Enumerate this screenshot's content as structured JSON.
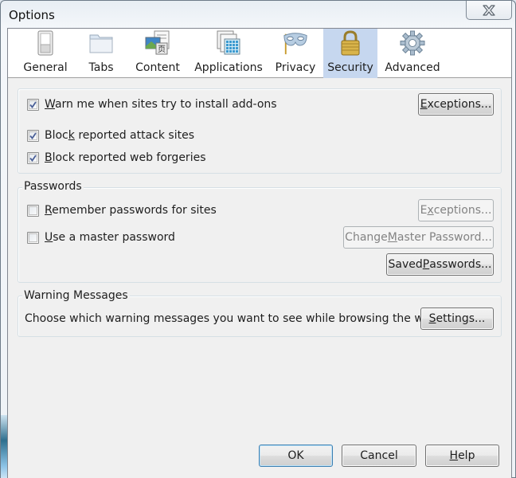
{
  "window": {
    "title": "Options",
    "close_label": "Close"
  },
  "panes": [
    {
      "id": "general",
      "label": "General",
      "icon": "switch-icon",
      "selected": false
    },
    {
      "id": "tabs",
      "label": "Tabs",
      "icon": "folder-tabs-icon",
      "selected": false
    },
    {
      "id": "content",
      "label": "Content",
      "icon": "content-page-icon",
      "selected": false
    },
    {
      "id": "applications",
      "label": "Applications",
      "icon": "applications-grid-icon",
      "selected": false
    },
    {
      "id": "privacy",
      "label": "Privacy",
      "icon": "mask-icon",
      "selected": false
    },
    {
      "id": "security",
      "label": "Security",
      "icon": "padlock-icon",
      "selected": true
    },
    {
      "id": "advanced",
      "label": "Advanced",
      "icon": "gear-icon",
      "selected": false
    }
  ],
  "security": {
    "addons": {
      "checked": true,
      "label_pre": "",
      "label_access": "W",
      "label_post": "arn me when sites try to install add-ons",
      "exceptions_button": {
        "pre": "",
        "access": "E",
        "post": "xceptions...",
        "enabled": true
      }
    },
    "attack_sites": {
      "checked": true,
      "label_pre": "Bloc",
      "label_access": "k",
      "label_post": " reported attack sites"
    },
    "forgeries": {
      "checked": true,
      "label_pre": "",
      "label_access": "B",
      "label_post": "lock reported web forgeries"
    }
  },
  "passwords": {
    "caption": "Passwords",
    "remember": {
      "checked": false,
      "label_pre": "",
      "label_access": "R",
      "label_post": "emember passwords for sites",
      "exceptions_button": {
        "pre": "E",
        "access": "x",
        "post": "ceptions...",
        "enabled": false
      }
    },
    "master": {
      "checked": false,
      "label_pre": "",
      "label_access": "U",
      "label_post": "se a master password",
      "change_button": {
        "pre": "Change ",
        "access": "M",
        "post": "aster Password...",
        "enabled": false
      }
    },
    "saved_button": {
      "pre": "Saved ",
      "access": "P",
      "post": "asswords...",
      "enabled": true
    }
  },
  "warnings": {
    "caption": "Warning Messages",
    "description": "Choose which warning messages you want to see while browsing the web",
    "settings_button": {
      "pre": "",
      "access": "S",
      "post": "ettings...",
      "enabled": true
    }
  },
  "footer": {
    "ok": "OK",
    "cancel": "Cancel",
    "help": {
      "pre": "",
      "access": "H",
      "post": "elp"
    }
  }
}
